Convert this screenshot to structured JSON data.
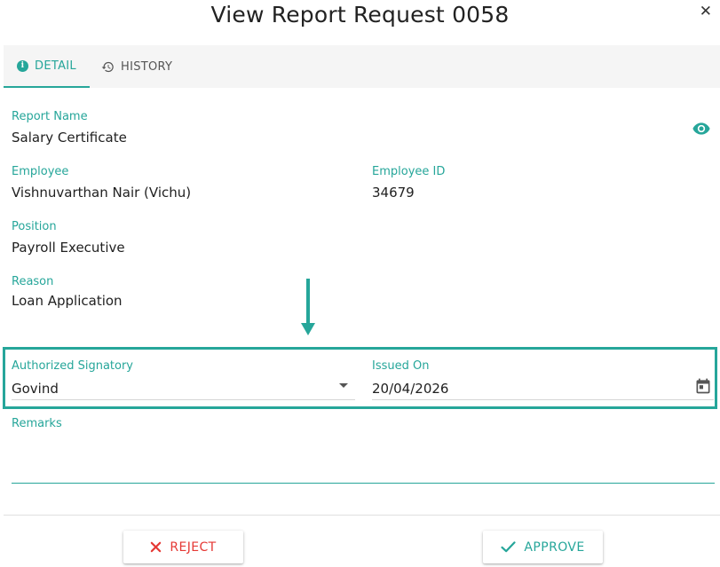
{
  "dialog": {
    "title": "View Report Request 0058",
    "close_glyph": "✕"
  },
  "tabs": [
    {
      "label": "DETAIL",
      "icon": "info-icon",
      "active": true
    },
    {
      "label": "HISTORY",
      "icon": "history-icon",
      "active": false
    }
  ],
  "fields": {
    "report_name": {
      "label": "Report Name",
      "value": "Salary Certificate"
    },
    "employee": {
      "label": "Employee",
      "value": "Vishnuvarthan Nair (Vichu)"
    },
    "employee_id": {
      "label": "Employee ID",
      "value": "34679"
    },
    "position": {
      "label": "Position",
      "value": "Payroll Executive"
    },
    "reason": {
      "label": "Reason",
      "value": "Loan Application"
    },
    "authorized_signatory": {
      "label": "Authorized Signatory",
      "value": "Govind"
    },
    "issued_on": {
      "label": "Issued On",
      "value": "20/04/2026"
    },
    "remarks": {
      "label": "Remarks",
      "value": ""
    }
  },
  "actions": {
    "reject_label": "REJECT",
    "approve_label": "APPROVE"
  },
  "colors": {
    "accent": "#26a69a",
    "reject": "#e53935"
  },
  "icons": {
    "close": "close-icon",
    "view": "eye-icon",
    "calendar": "calendar-icon",
    "dropdown": "chevron-down-icon",
    "annotation": "arrow-down-icon"
  }
}
